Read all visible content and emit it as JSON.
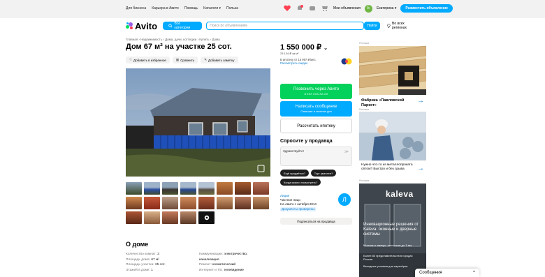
{
  "topbar": {
    "links": [
      "Для бизнеса",
      "Карьера в Авито",
      "Помощь",
      "Каталоги ▾",
      "Польза"
    ],
    "my_ads": "Мои объявления",
    "user_initial": "Е",
    "user_name": "Екатерина ▾",
    "post_ad": "Разместить объявление"
  },
  "header": {
    "logo": "Avito",
    "categories_button": "Все категории",
    "search_placeholder": "Поиск по объявлениям",
    "find_button": "Найти",
    "region": "Во всех регионах"
  },
  "listing": {
    "breadcrumb": "Главная › Недвижимость › Дома, дачи, коттеджи › Купить › Дома",
    "title": "Дом 67 м² на участке 25 сот.",
    "actions": {
      "favorite": "Добавить в избранное",
      "compare": "Сравнить",
      "note": "Добавить заметку"
    },
    "about_title": "О доме",
    "params_left": [
      {
        "k": "Количество комнат:",
        "v": "3"
      },
      {
        "k": "Площадь дома:",
        "v": "67 м²"
      },
      {
        "k": "Площадь участка:",
        "v": "25 сот."
      },
      {
        "k": "Этажей в доме:",
        "v": "1"
      }
    ],
    "params_right": [
      {
        "k": "Коммуникации:",
        "v": "электричество, канализация"
      },
      {
        "k": "Ремонт:",
        "v": "косметический"
      },
      {
        "k": "Интернет и ТВ:",
        "v": "телевидение"
      }
    ]
  },
  "sidebar": {
    "price": "1 550 000 ₽",
    "price_per_m": "23 134 ₽ за м²",
    "mortgage": "В ипотеку от 15 997 ₽/мес.",
    "mortgage_link": "Рассмотреть скидки",
    "call_button": "Позвонить через Авито",
    "call_sub": "8 ХХХ ХХХ-ХХ-ХХ",
    "write_button": "Написать сообщение",
    "write_sub": "Отвечает в течение дня",
    "calc_button": "Рассчитать ипотеку",
    "ask_title": "Спросите у продавца",
    "message_value": "Здравствуйте!",
    "chips": [
      "Ещё продаётся?",
      "Торг уместен?",
      "Когда можно посмотреть?"
    ],
    "seller_name": "Лидия",
    "seller_type": "Частное лицо",
    "seller_since": "На Авито с октября 2014",
    "seller_docs": "Документы проверены",
    "seller_initial": "Л",
    "subscribe": "Подписаться на продавца"
  },
  "ads": {
    "label": "Реклама",
    "ad1_title": "Фабрика «Павловский Паркет»",
    "ad2_title": "Нужно что-то из металлопроката оптом? Быстро и без срыва",
    "ad3_brand": "kaleva",
    "ad3_head": "Инновационные решения от Kaleva: оконные и дверные системы",
    "ad3_bullets": [
      "Монтаж и замеры точностью до 1 мм",
      "Более 80 представительств в городах России",
      "Выгодные условия для партнёров"
    ]
  },
  "messages_panel": {
    "label": "Сообщения",
    "chevron": "^"
  },
  "colors": {
    "accent": "#00aaff",
    "green": "#02d15c",
    "link": "#0a7ecd"
  }
}
